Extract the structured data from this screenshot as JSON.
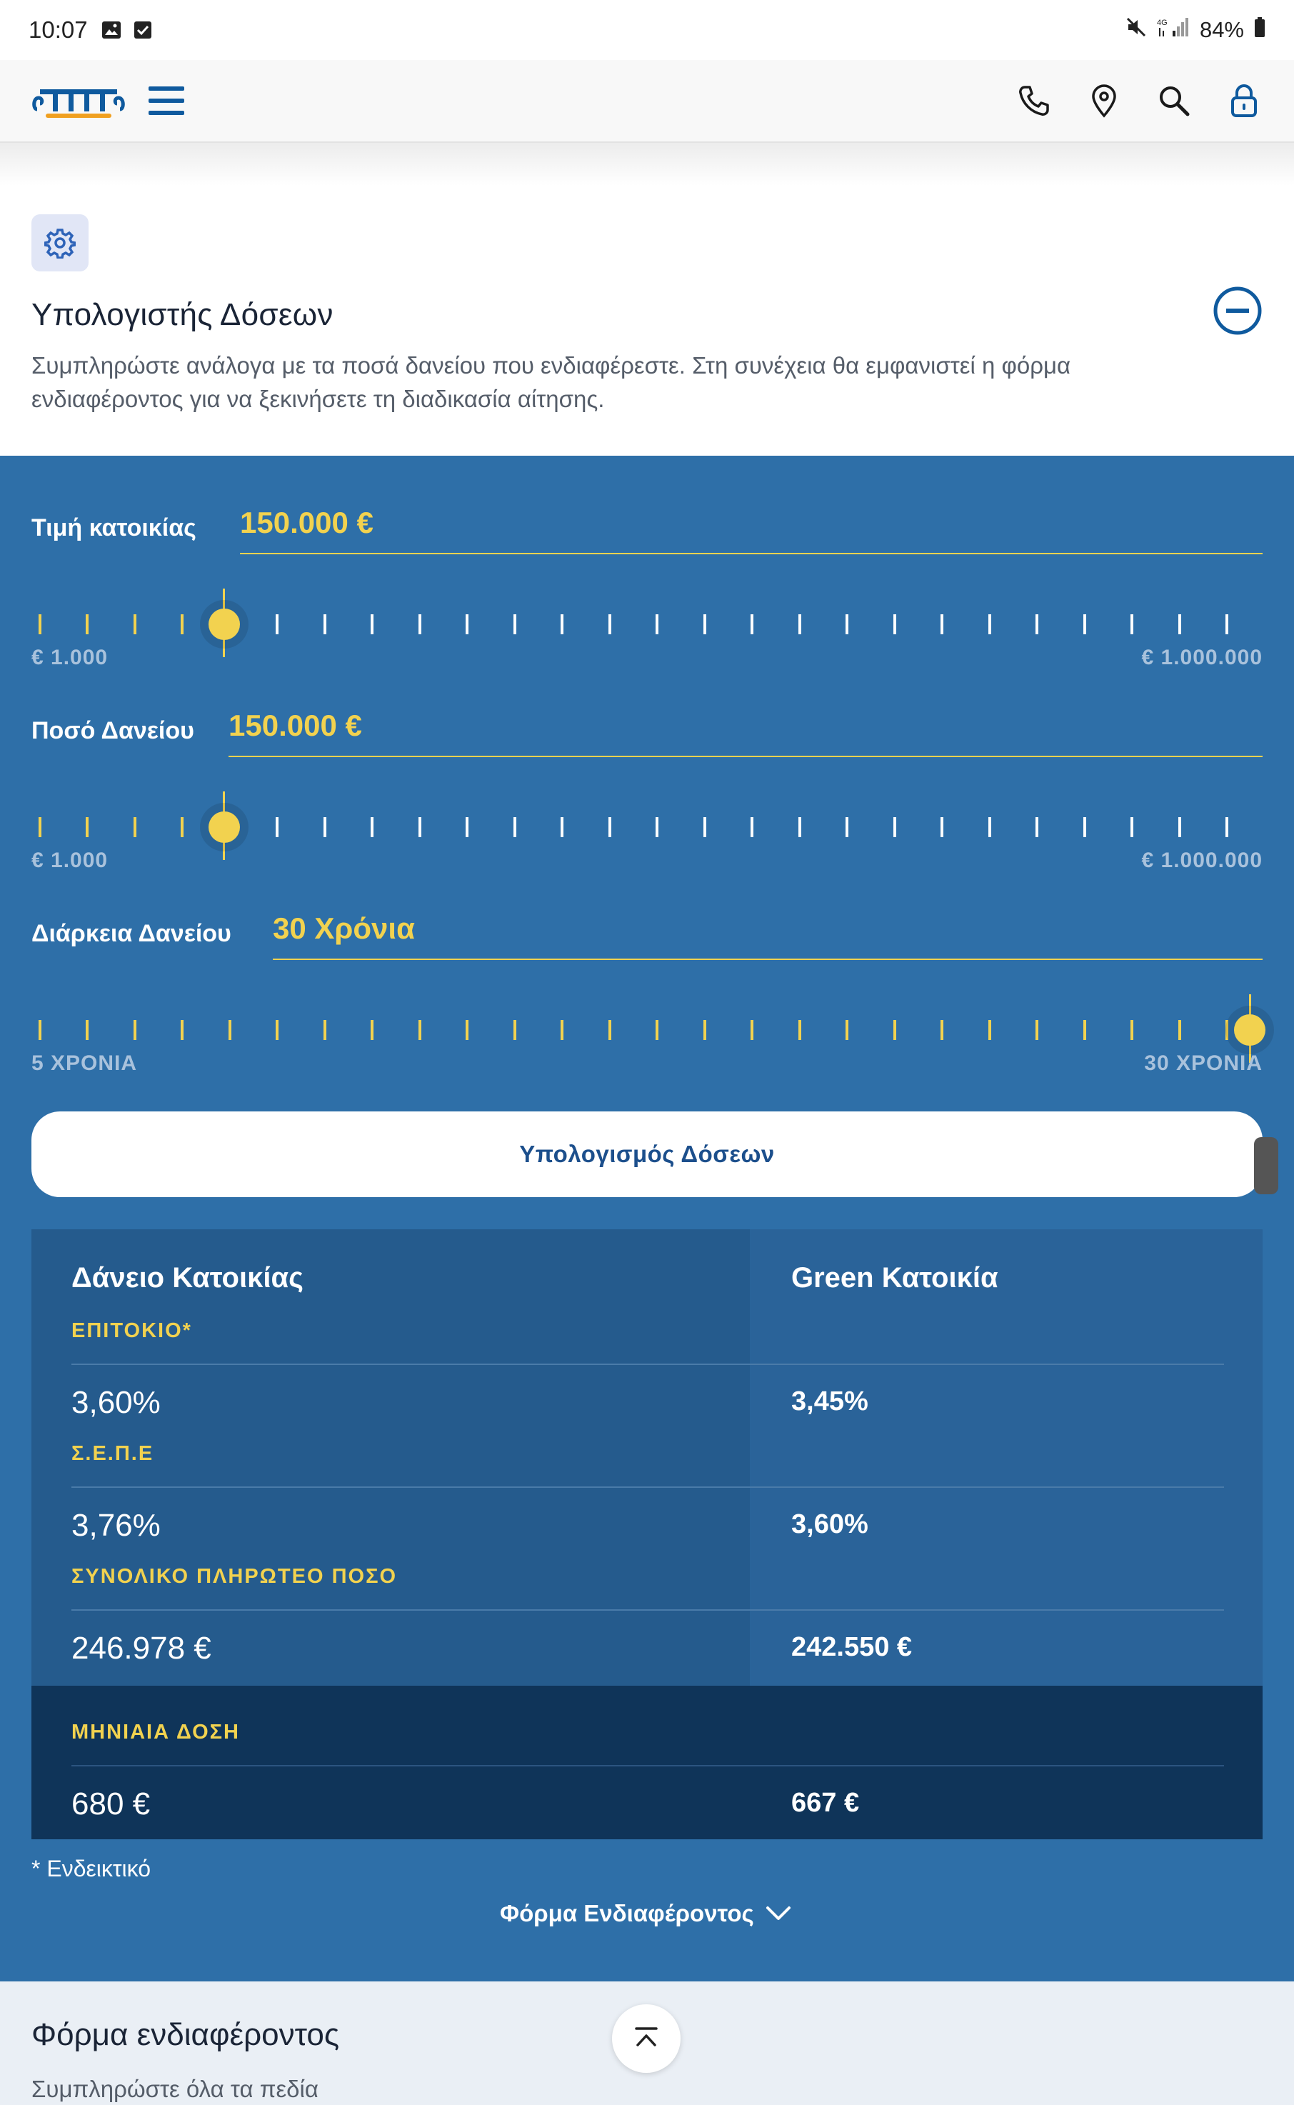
{
  "status_bar": {
    "time": "10:07",
    "battery": "84%",
    "left_icons": [
      "image-icon",
      "checkbox-icon"
    ],
    "right_icons": [
      "mute-icon",
      "4g-signal-icon",
      "battery-icon"
    ]
  },
  "header": {
    "logo": "bank-logo",
    "icons": [
      "phone-icon",
      "location-icon",
      "search-icon",
      "lock-icon"
    ]
  },
  "intro": {
    "icon": "gear-icon",
    "title": "Υπολογιστής Δόσεων",
    "description": "Συμπληρώστε ανάλογα με τα ποσά δανείου που ενδιαφέρεστε. Στη συνέχεια θα εμφανιστεί η φόρμα ενδιαφέροντος για να ξεκινήσετε τη διαδικασία αίτησης."
  },
  "calculator": {
    "fields": [
      {
        "label": "Τιμή κατοικίας",
        "value": "150.000 €",
        "min_label": "€ 1.000",
        "max_label": "€ 1.000.000",
        "slider_fraction": 0.149
      },
      {
        "label": "Ποσό Δανείου",
        "value": "150.000 €",
        "min_label": "€ 1.000",
        "max_label": "€ 1.000.000",
        "slider_fraction": 0.149
      },
      {
        "label": "Διάρκεια Δανείου",
        "value": "30 Χρόνια",
        "min_label": "5 ΧΡΟΝΙΑ",
        "max_label": "30 ΧΡΟΝΙΑ",
        "slider_fraction": 1.0
      }
    ],
    "button_label": "Υπολογισμός Δόσεων"
  },
  "results": {
    "columns": [
      "Δάνειο Κατοικίας",
      "Green Κατοικία"
    ],
    "rows": [
      {
        "label": "ΕΠΙΤΟΚΙΟ*",
        "values": [
          "3,60%",
          "3,45%"
        ]
      },
      {
        "label": "Σ.Ε.Π.Ε",
        "values": [
          "3,76%",
          "3,60%"
        ]
      },
      {
        "label": "ΣΥΝΟΛΙΚΟ ΠΛΗΡΩΤΕΟ ΠΟΣΟ",
        "values": [
          "246.978 €",
          "242.550 €"
        ]
      }
    ],
    "monthly": {
      "label": "ΜΗΝΙΑΙΑ ΔΟΣΗ",
      "values": [
        "680 €",
        "667 €"
      ]
    },
    "footnote": "* Ενδεικτικό",
    "form_link": "Φόρμα Ενδιαφέροντος"
  },
  "form_section": {
    "title": "Φόρμα ενδιαφέροντος",
    "subtitle": "Συμπληρώστε όλα τα πεδία"
  },
  "colors": {
    "accent": "#f2d24f",
    "calc_bg": "#2e6fa8",
    "brand": "#0f5a9e"
  }
}
